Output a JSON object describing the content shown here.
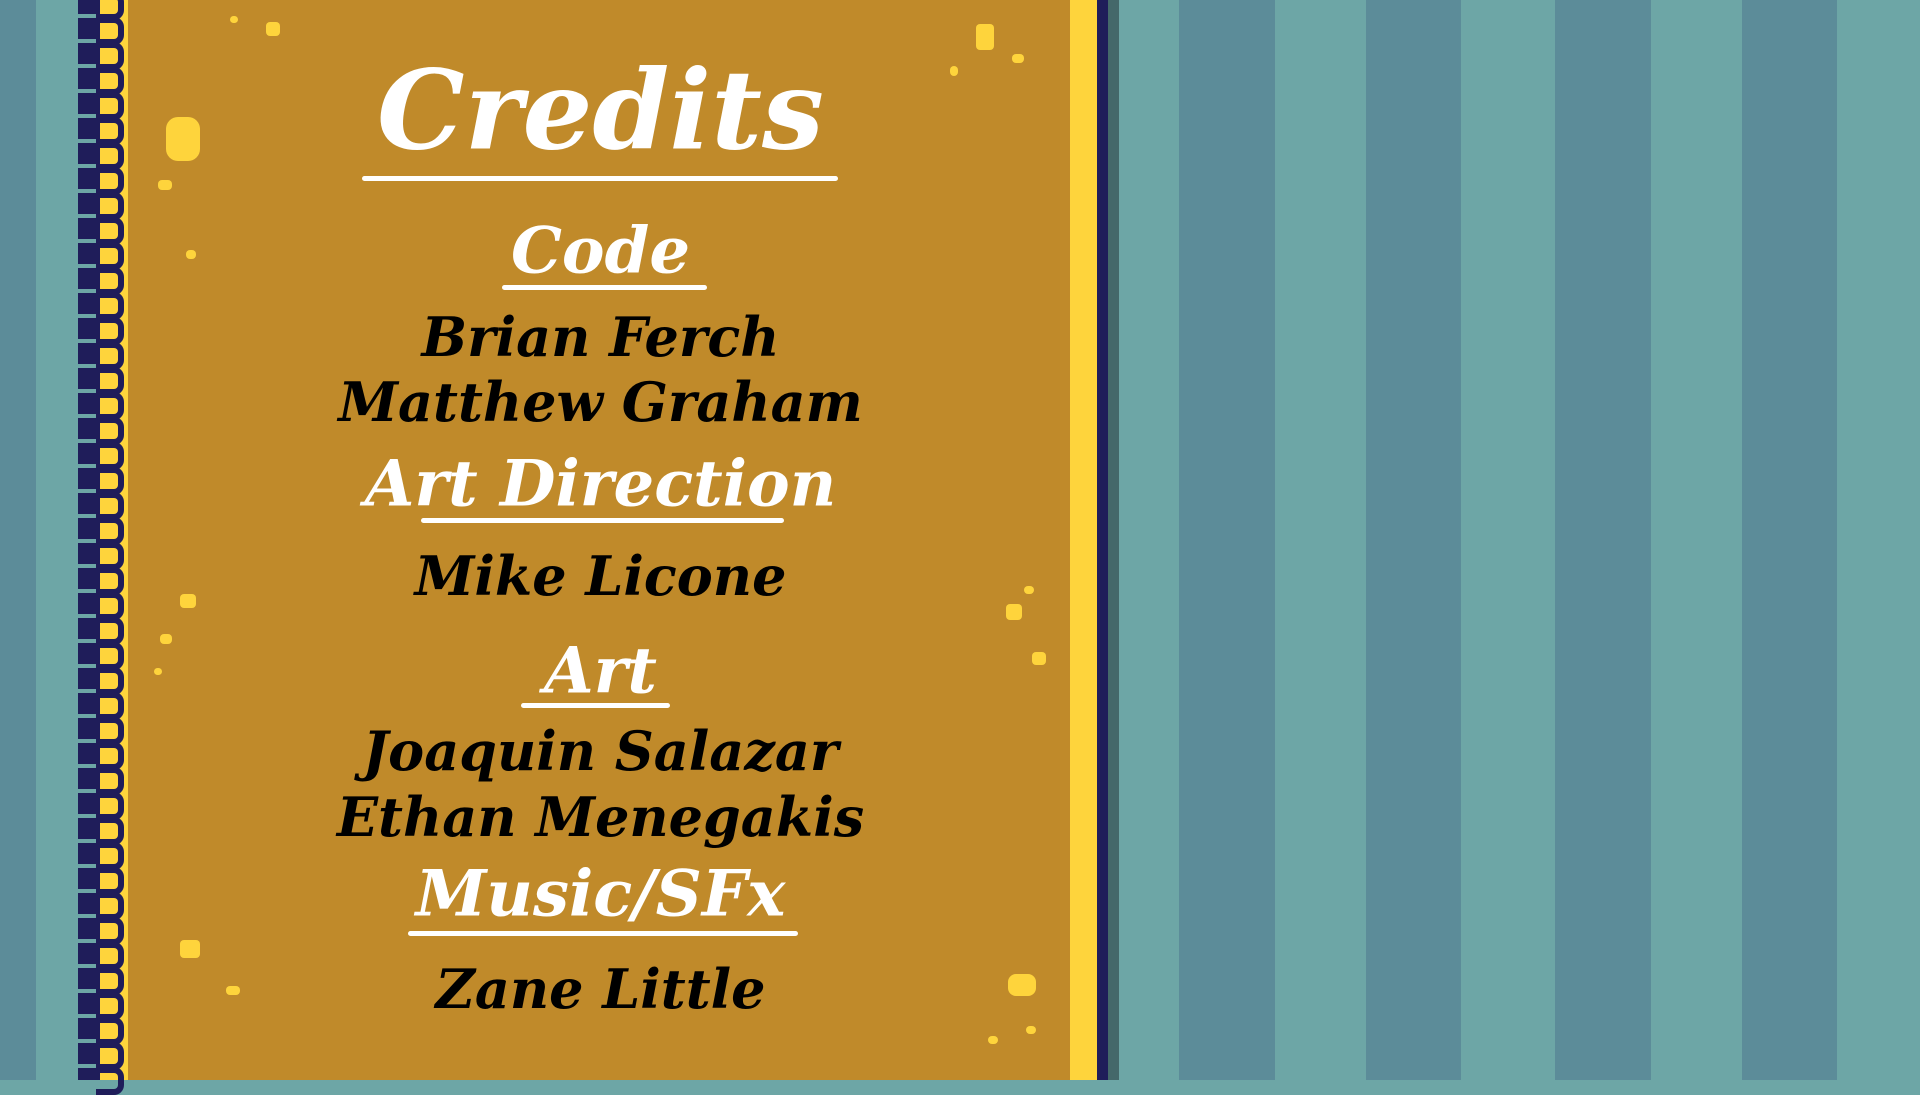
{
  "title": "Credits",
  "sections": [
    {
      "heading": "Code",
      "names": [
        "Brian Ferch",
        "Matthew Graham"
      ]
    },
    {
      "heading": "Art Direction",
      "names": [
        "Mike Licone"
      ]
    },
    {
      "heading": "Art",
      "names": [
        "Joaquin Salazar",
        "Ethan Menegakis"
      ]
    },
    {
      "heading": "Music/SFx",
      "names": [
        "Zane Little"
      ]
    }
  ],
  "colors": {
    "panel": "#c08a2a",
    "accent": "#fed43c",
    "navy": "#1f1d5a",
    "stripe_light": "#6da6a6",
    "stripe_dark": "#5c8c99"
  }
}
